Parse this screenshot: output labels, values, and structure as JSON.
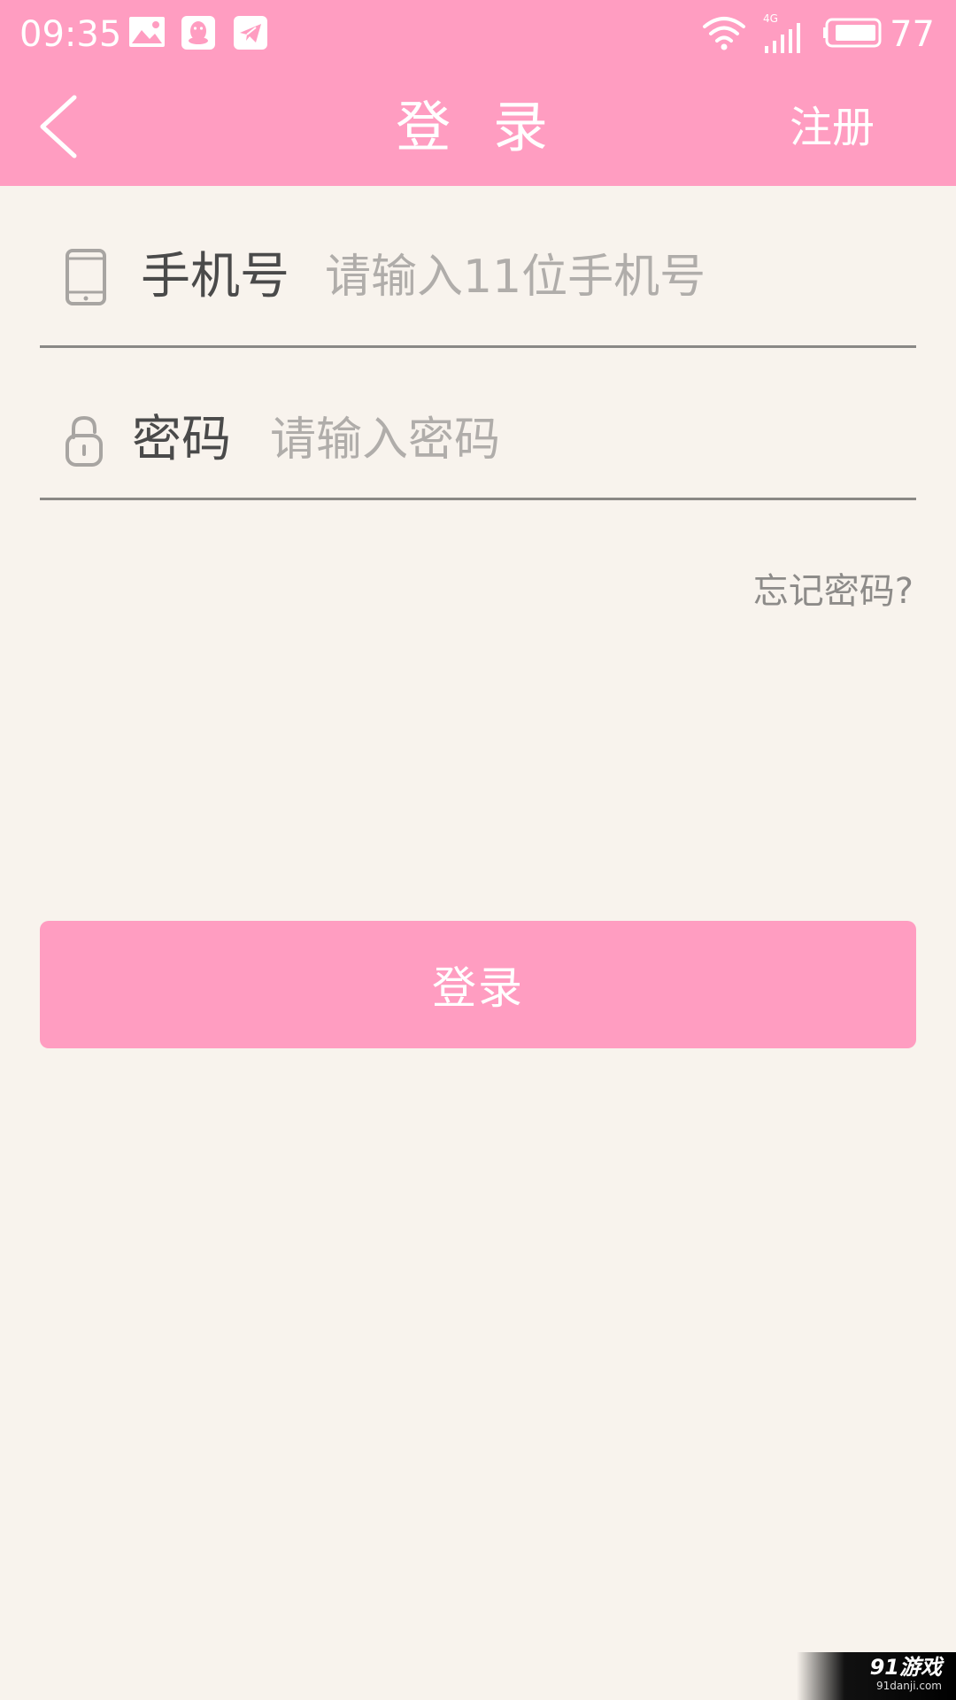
{
  "status_bar": {
    "time": "09:35",
    "battery_level": "77",
    "network_label": "4G",
    "icons": [
      "image-icon",
      "qq-icon",
      "telegram-icon",
      "wifi-icon",
      "signal-icon",
      "battery-icon"
    ]
  },
  "app_bar": {
    "title": "登 录",
    "register_label": "注册",
    "back_icon": "chevron-left-icon"
  },
  "form": {
    "phone": {
      "label": "手机号",
      "placeholder": "请输入11位手机号",
      "value": "",
      "icon": "phone-icon"
    },
    "password": {
      "label": "密码",
      "placeholder": "请输入密码",
      "value": "",
      "icon": "lock-icon"
    },
    "forgot_label": "忘记密码?",
    "login_label": "登录"
  },
  "watermark": {
    "brand": "91游戏",
    "site": "91danji.com"
  },
  "colors": {
    "accent": "#ff9dc1",
    "background": "#f8f3ed",
    "divider": "#8a8885"
  }
}
